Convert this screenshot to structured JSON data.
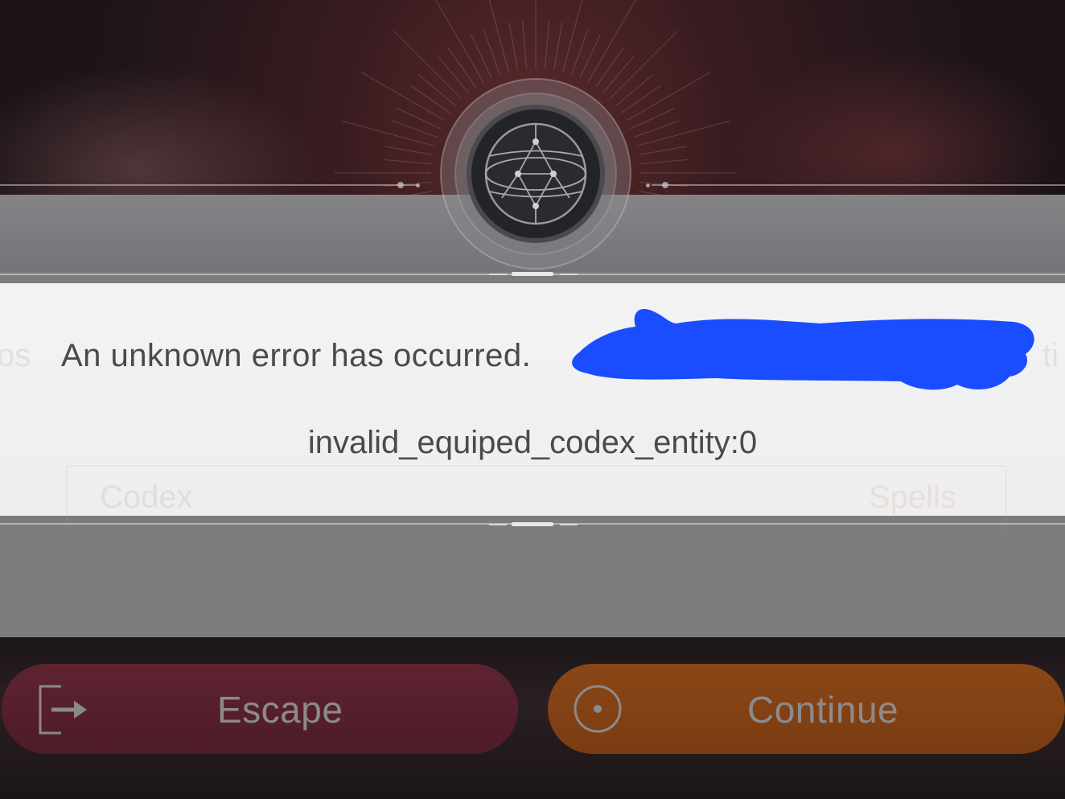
{
  "dialog": {
    "error_title": "An unknown error has occurred.",
    "error_code": "invalid_equiped_codex_entity:0"
  },
  "background_ghost": {
    "left_fragment": "os",
    "right_fragment": "ti",
    "tab_left": "Codex",
    "tab_right": "Spells"
  },
  "actions": {
    "escape_label": "Escape",
    "escape_icon": "exit-icon",
    "continue_label": "Continue",
    "continue_icon": "target-icon"
  },
  "colors": {
    "escape_button": "#561f2c",
    "continue_button": "#824114",
    "redaction_scribble": "#1a4dff"
  }
}
